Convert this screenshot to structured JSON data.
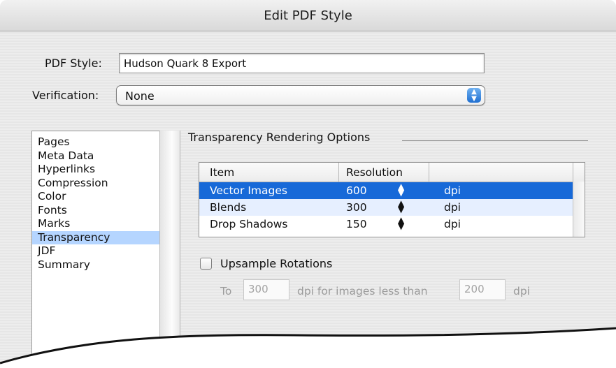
{
  "window": {
    "title": "Edit PDF Style"
  },
  "form": {
    "pdf_style_label": "PDF Style:",
    "pdf_style_value": "Hudson Quark 8 Export",
    "verification_label": "Verification:",
    "verification_value": "None"
  },
  "sidebar": {
    "items": [
      {
        "label": "Pages"
      },
      {
        "label": "Meta Data"
      },
      {
        "label": "Hyperlinks"
      },
      {
        "label": "Compression"
      },
      {
        "label": "Color"
      },
      {
        "label": "Fonts"
      },
      {
        "label": "Marks"
      },
      {
        "label": "Transparency"
      },
      {
        "label": "JDF"
      },
      {
        "label": "Summary"
      }
    ],
    "selected": "Transparency"
  },
  "transparency": {
    "section_title": "Transparency Rendering Options",
    "table": {
      "headers": [
        "Item",
        "Resolution",
        ""
      ],
      "rows": [
        {
          "item": "Vector Images",
          "resolution": "600",
          "unit": "dpi"
        },
        {
          "item": "Blends",
          "resolution": "300",
          "unit": "dpi"
        },
        {
          "item": "Drop Shadows",
          "resolution": "150",
          "unit": "dpi"
        }
      ],
      "selected_row": "Vector Images"
    },
    "upsample": {
      "label": "Upsample Rotations",
      "checked": false,
      "to_label": "To",
      "to_value": "300",
      "mid_label": "dpi for images less than",
      "less_than_value": "200",
      "end_label": "dpi"
    }
  },
  "icons": {
    "popup_arrows": "up-down-arrows-icon",
    "stepper": "stepper-icon"
  },
  "colors": {
    "selection_blue": "#1769d8",
    "sidebar_selection": "#b5d5ff",
    "alternate_row": "#e6efff"
  }
}
